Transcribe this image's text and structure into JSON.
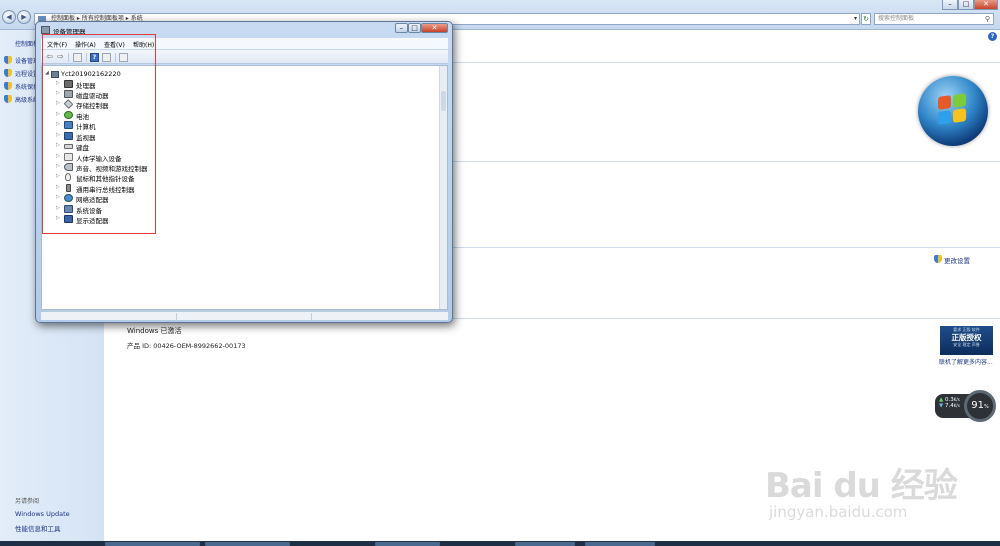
{
  "control_panel": {
    "breadcrumb": [
      "控制面板",
      "所有控制面板项",
      "系统"
    ],
    "search_placeholder": "搜索控制面板",
    "sidebar": {
      "home_label": "控制面板",
      "links": [
        {
          "label": "设备管理器"
        },
        {
          "label": "远程设置"
        },
        {
          "label": "系统保护"
        },
        {
          "label": "高级系统设置"
        }
      ],
      "see_also_heading": "另请参阅",
      "bottom_links": [
        {
          "label": "Windows Update"
        },
        {
          "label": "性能信息和工具"
        }
      ]
    },
    "change_settings_label": "更改设置",
    "activation_status": "Windows 已激活",
    "product_id": "产品 ID: 00426-OEM-8992662-00173",
    "genuine_badge": {
      "line1": "要求 正版 软件",
      "main": "正版授权",
      "line2": "安全 稳定 声誉"
    },
    "genuine_link": "联机了解更多内容..."
  },
  "device_manager": {
    "title": "设备管理器",
    "menu": [
      {
        "label": "文件(F)"
      },
      {
        "label": "操作(A)"
      },
      {
        "label": "查看(V)"
      },
      {
        "label": "帮助(H)"
      }
    ],
    "tree_root": "Yct201902162220",
    "devices": [
      {
        "label": "处理器",
        "icon": "cpu-icon"
      },
      {
        "label": "磁盘驱动器",
        "icon": "disk-drive-icon"
      },
      {
        "label": "存储控制器",
        "icon": "storage-controller-icon"
      },
      {
        "label": "电池",
        "icon": "battery-icon"
      },
      {
        "label": "计算机",
        "icon": "computer-icon"
      },
      {
        "label": "监视器",
        "icon": "monitor-icon"
      },
      {
        "label": "键盘",
        "icon": "keyboard-icon"
      },
      {
        "label": "人体学输入设备",
        "icon": "hid-icon"
      },
      {
        "label": "声音、视频和游戏控制器",
        "icon": "sound-icon"
      },
      {
        "label": "鼠标和其他指针设备",
        "icon": "mouse-icon"
      },
      {
        "label": "通用串行总线控制器",
        "icon": "usb-icon"
      },
      {
        "label": "网络适配器",
        "icon": "network-adapter-icon"
      },
      {
        "label": "系统设备",
        "icon": "system-device-icon"
      },
      {
        "label": "显示适配器",
        "icon": "display-adapter-icon"
      }
    ]
  },
  "net_widget": {
    "upload": "0.3",
    "upload_unit": "K/s",
    "download": "7.4",
    "download_unit": "K/s",
    "percent": "91",
    "percent_unit": "%"
  },
  "watermark": {
    "brand": "Bai du 经验",
    "url": "jingyan.baidu.com"
  },
  "colors": {
    "highlight_box": "#e03c3c",
    "link": "#1e3287",
    "title_bar": "#b3cbe8"
  }
}
